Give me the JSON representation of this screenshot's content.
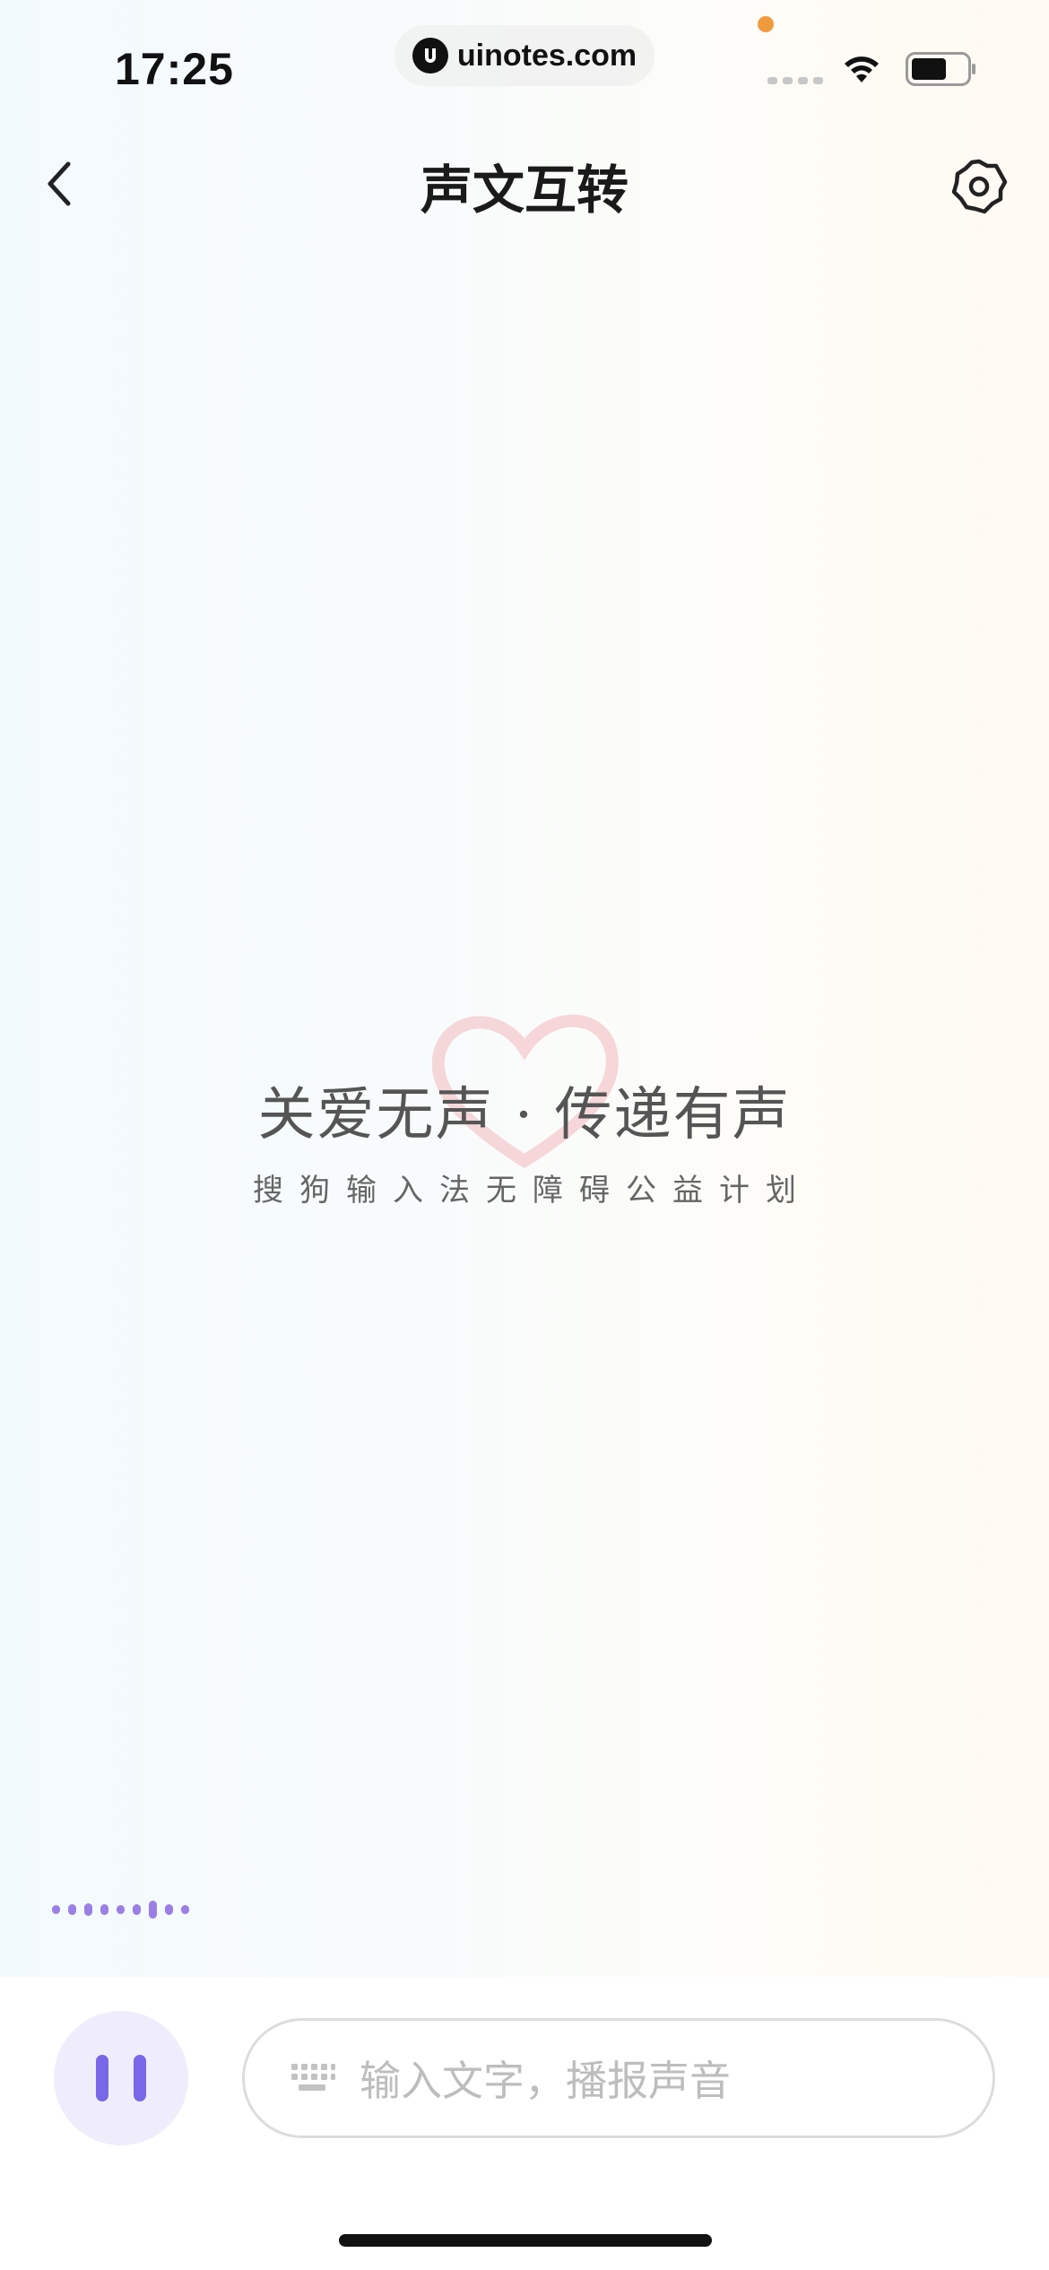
{
  "status_bar": {
    "time": "17:25",
    "watermark": "uinotes.com"
  },
  "header": {
    "title": "声文互转"
  },
  "center": {
    "slogan": "关爱无声 · 传递有声",
    "subtitle": "搜狗输入法无障碍公益计划"
  },
  "input_bar": {
    "placeholder": "输入文字，播报声音"
  },
  "icons": {
    "back": "chevron-left-icon",
    "settings": "gear-icon",
    "pause": "pause-icon",
    "keyboard": "keyboard-icon",
    "heart": "heart-icon"
  },
  "colors": {
    "accent": "#7867e6",
    "wave": "#9b7fe6",
    "pause_bg": "#efedfb"
  }
}
